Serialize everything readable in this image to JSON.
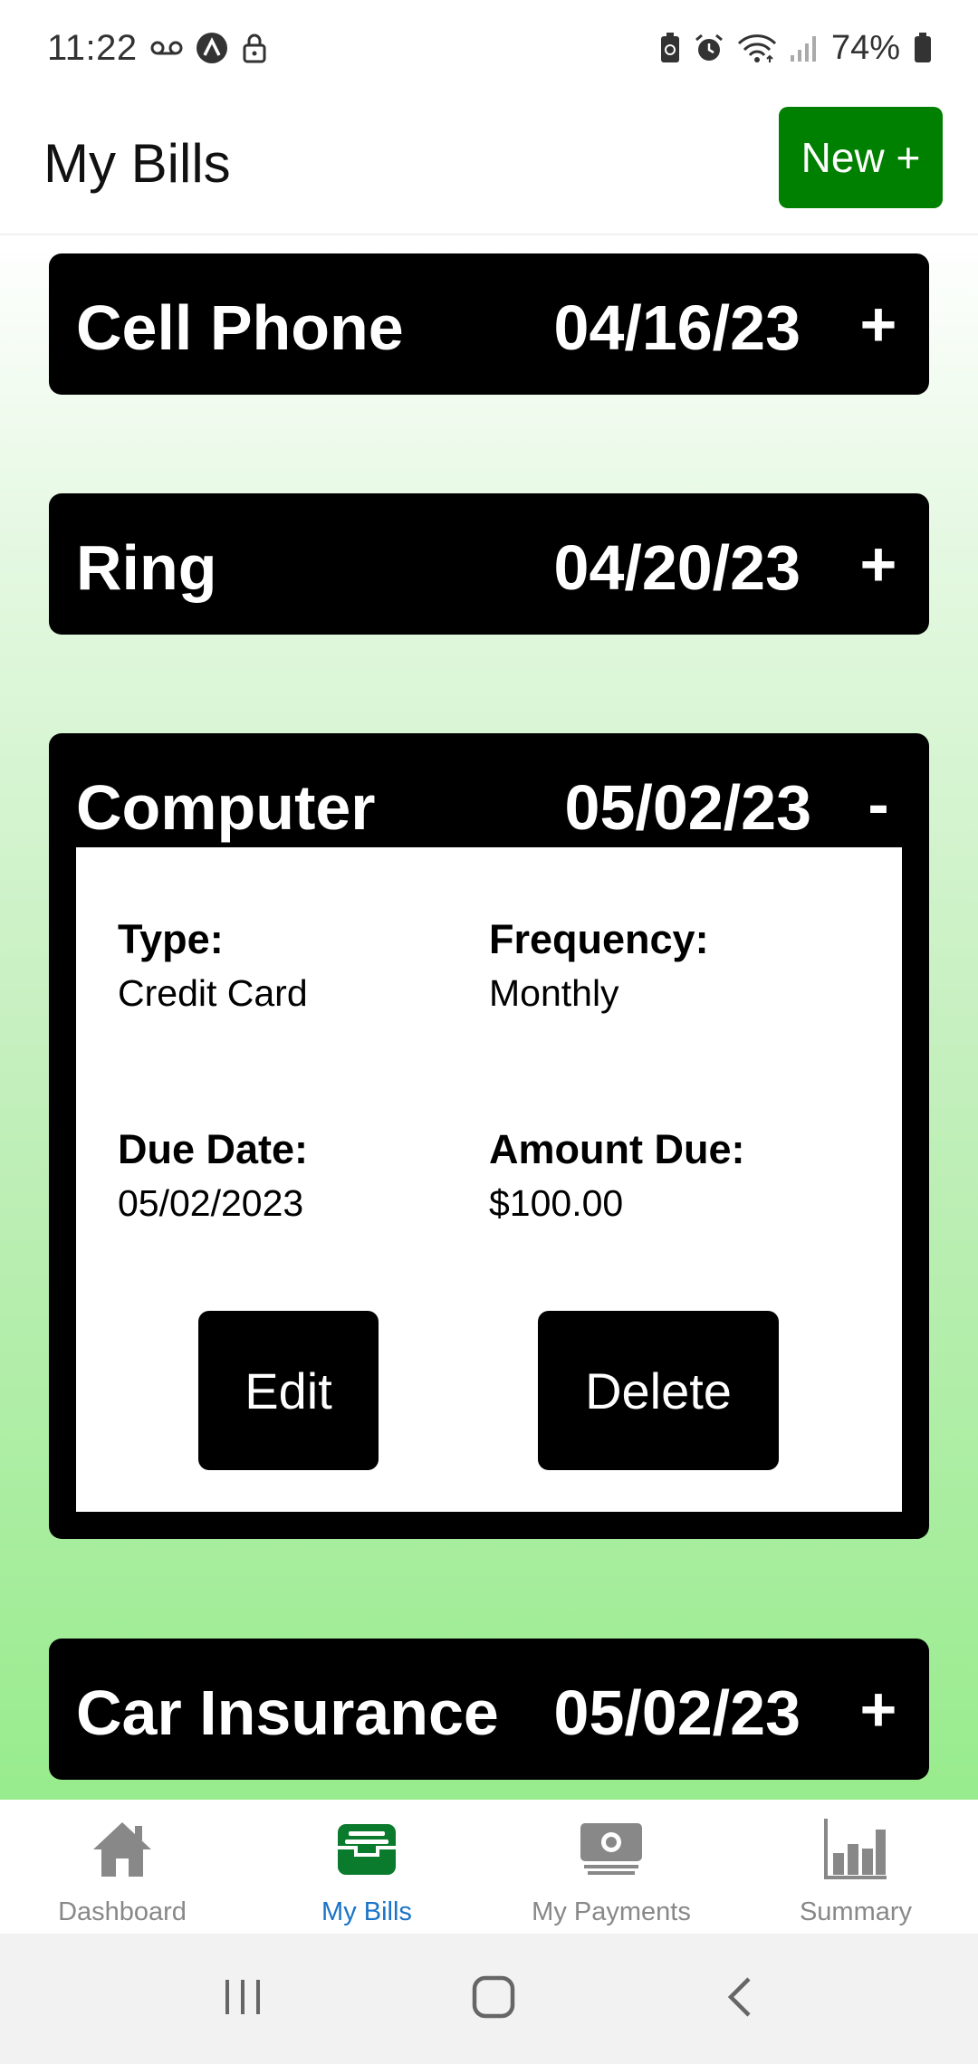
{
  "status_bar": {
    "time": "11:22",
    "battery_pct": "74%",
    "icons_left": [
      "voicemail-icon",
      "app-badge-icon",
      "lock-icon"
    ],
    "icons_right": [
      "battery-saver-icon",
      "alarm-icon",
      "wifi-icon",
      "signal-icon",
      "battery-icon"
    ]
  },
  "header": {
    "title": "My Bills",
    "new_button_label": "New +"
  },
  "bills": [
    {
      "name": "Cell Phone",
      "date": "04/16/23",
      "toggle": "+",
      "expanded": false
    },
    {
      "name": "Ring",
      "date": "04/20/23",
      "toggle": "+",
      "expanded": false
    },
    {
      "name": "Computer",
      "date": "05/02/23",
      "toggle": "-",
      "expanded": true,
      "details": {
        "type_label": "Type:",
        "type_value": "Credit Card",
        "frequency_label": "Frequency:",
        "frequency_value": "Monthly",
        "due_date_label": "Due Date:",
        "due_date_value": "05/02/2023",
        "amount_label": "Amount Due:",
        "amount_value": "$100.00",
        "edit_label": "Edit",
        "delete_label": "Delete"
      }
    },
    {
      "name": "Car Insurance",
      "date": "05/02/23",
      "toggle": "+",
      "expanded": false
    }
  ],
  "bottom_nav": [
    {
      "label": "Dashboard",
      "icon": "home-icon",
      "active": false
    },
    {
      "label": "My Bills",
      "icon": "inbox-tray-icon",
      "active": true
    },
    {
      "label": "My Payments",
      "icon": "money-icon",
      "active": false
    },
    {
      "label": "Summary",
      "icon": "bar-chart-icon",
      "active": false
    }
  ],
  "colors": {
    "accent_green": "#008000",
    "active_tab_icon": "#0a7a2c",
    "active_tab_label": "#1a73c8",
    "inactive_tab": "#888888"
  }
}
